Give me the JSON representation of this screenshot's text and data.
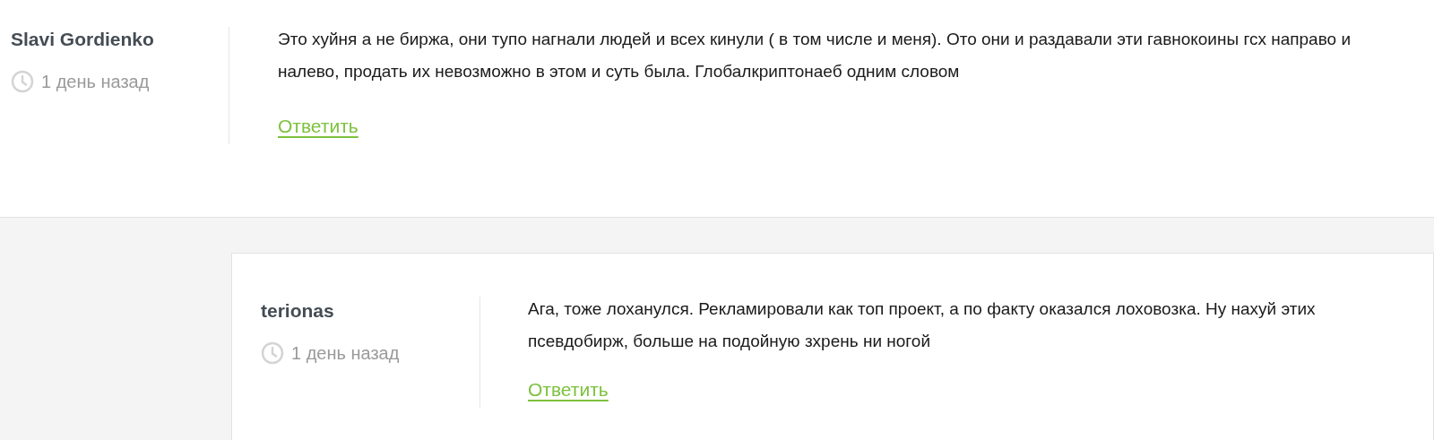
{
  "comments": [
    {
      "author": "Slavi Gordienko",
      "time": "1 день назад",
      "text": "Это хуйня а не биржа, они тупо нагнали людей и всех кинули ( в том числе и меня). Ото они и раздавали эти гавнокоины гсх направо и налево, продать их невозможно в этом и суть была. Глобалкриптонаеб одним словом",
      "reply": "Ответить",
      "replies": [
        {
          "author": "terionas",
          "time": "1 день назад",
          "text": "Ага, тоже лоханулся. Рекламировали как топ проект, а по факту оказался лоховозка. Ну нахуй этих псевдобирж, больше на подойную зхрень ни ногой",
          "reply": "Ответить"
        }
      ]
    }
  ]
}
